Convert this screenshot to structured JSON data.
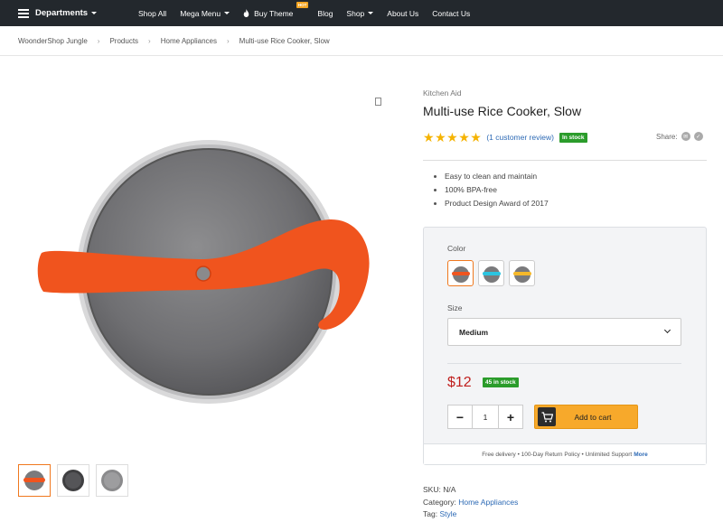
{
  "nav": {
    "departments": "Departments",
    "items": [
      {
        "label": "Shop All",
        "dropdown": false
      },
      {
        "label": "Mega Menu",
        "dropdown": true
      },
      {
        "label": "Buy Theme",
        "dropdown": false,
        "badge": "HOT"
      },
      {
        "label": "Blog",
        "dropdown": false
      },
      {
        "label": "Shop",
        "dropdown": true
      },
      {
        "label": "About Us",
        "dropdown": false
      },
      {
        "label": "Contact Us",
        "dropdown": false
      }
    ]
  },
  "breadcrumb": [
    "WoonderShop Jungle",
    "Products",
    "Home Appliances",
    "Multi-use Rice Cooker, Slow"
  ],
  "product": {
    "brand": "Kitchen Aid",
    "title": "Multi-use Rice Cooker, Slow",
    "rating": 5,
    "review_text": "(1 customer review)",
    "stock_badge": "In stock",
    "share_label": "Share:",
    "features": [
      "Easy to clean and maintain",
      "100% BPA-free",
      "Product Design Award of 2017"
    ]
  },
  "options": {
    "color_label": "Color",
    "color_swatches": [
      "orange",
      "cyan",
      "yellow"
    ],
    "size_label": "Size",
    "size_value": "Medium",
    "price": "$12",
    "qty_badge": "45 in stock",
    "quantity": "1",
    "add_to_cart": "Add to cart",
    "footer_text": "Free delivery • 100-Day Return Policy • Unlimited Support",
    "footer_more": "More"
  },
  "meta": {
    "sku_label": "SKU:",
    "sku_value": "N/A",
    "category_label": "Category:",
    "category_value": "Home Appliances",
    "tag_label": "Tag:",
    "tag_value": "Style"
  },
  "colors": {
    "nav_bg": "#23282d",
    "accent": "#f7a92b",
    "price": "#c0201e",
    "badge_green": "#2b9c2b",
    "link": "#2d6ab5",
    "product_orange": "#f0541e"
  }
}
